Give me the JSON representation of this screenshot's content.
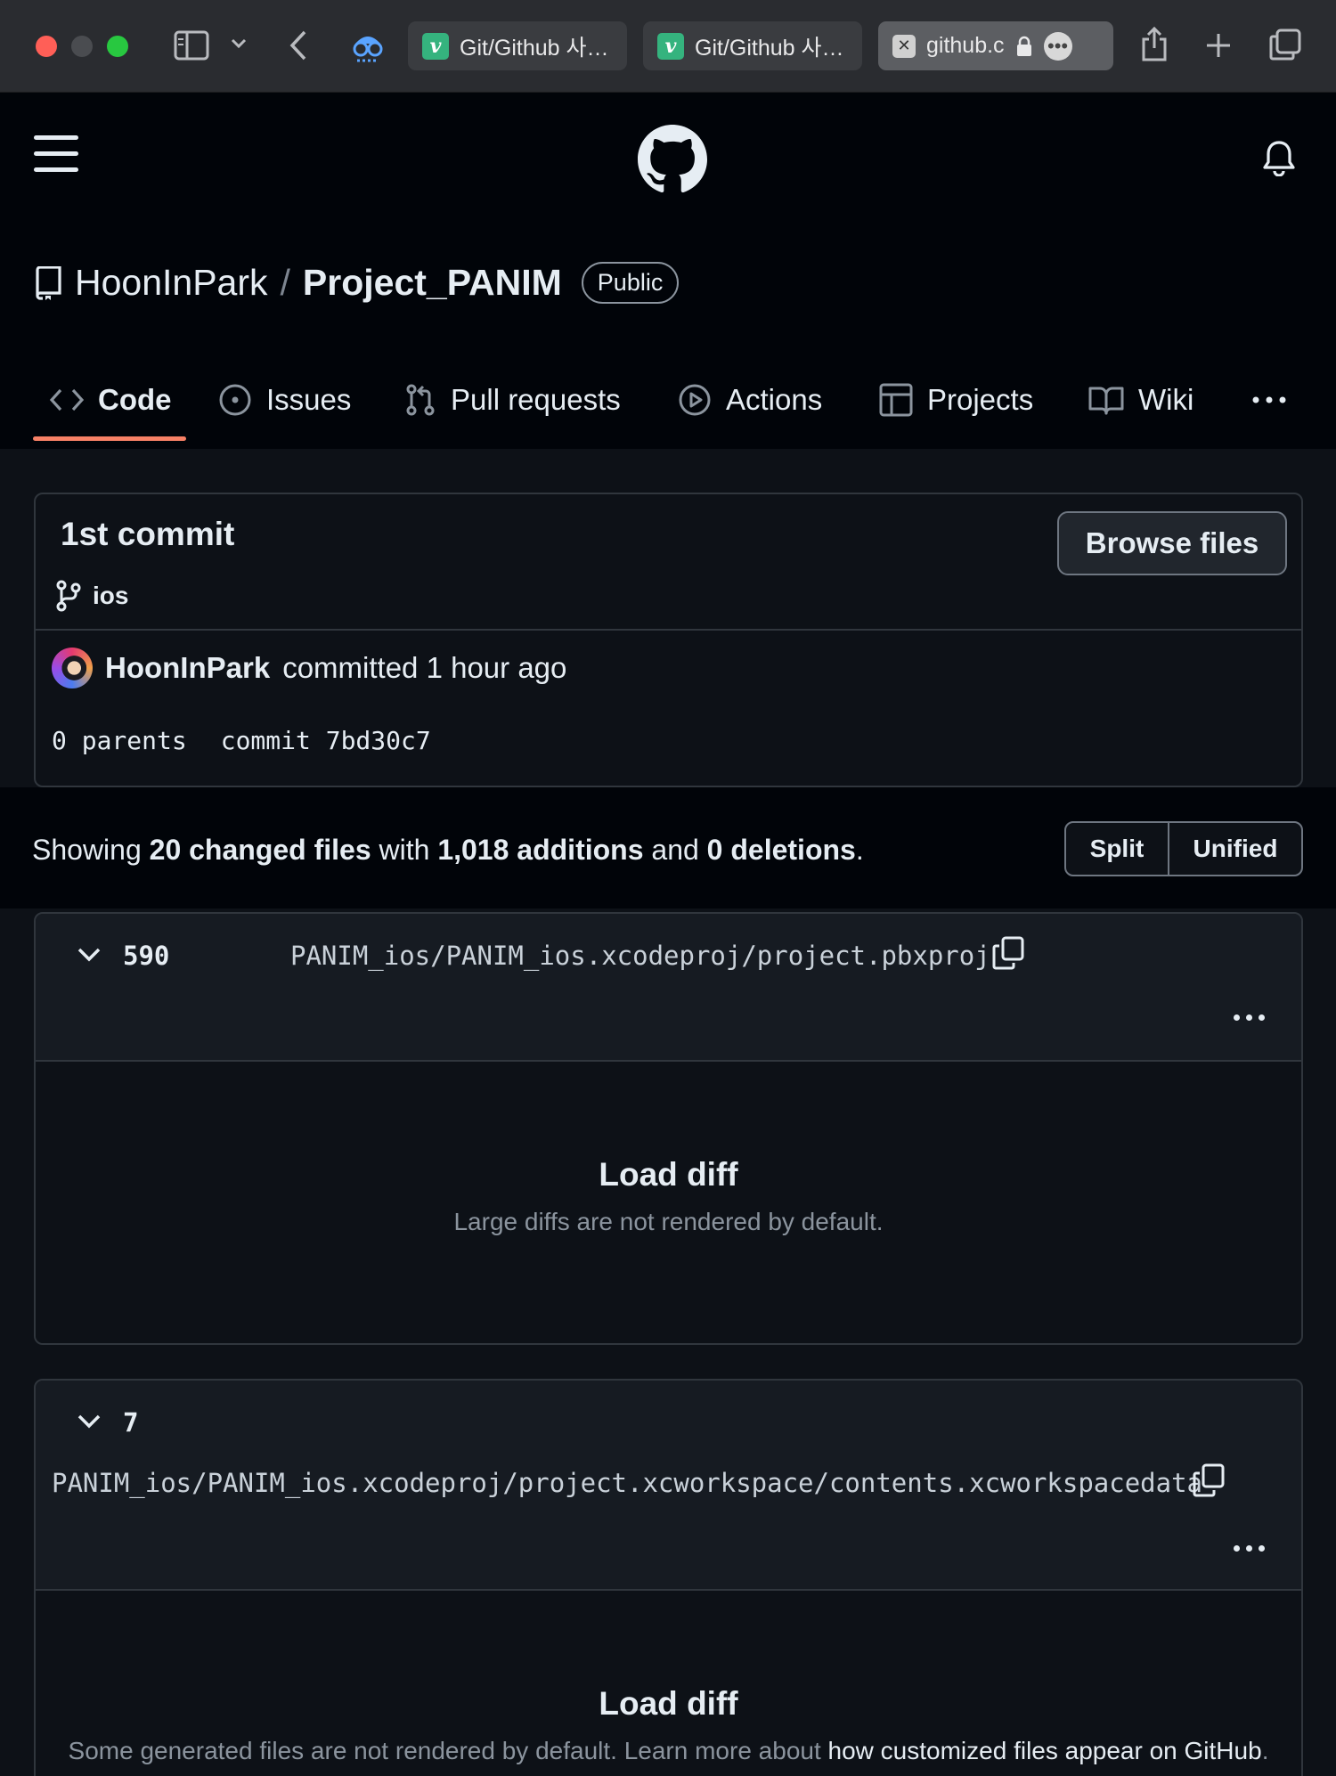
{
  "browser": {
    "tabs": [
      {
        "label": "Git/Github 사…",
        "favicon": "v-favicon",
        "active": false
      },
      {
        "label": "Git/Github 사…",
        "favicon": "v-favicon",
        "active": false
      },
      {
        "label": "github.c",
        "favicon": "x-favicon",
        "active": true
      }
    ]
  },
  "repo": {
    "owner": "HoonInPark",
    "separator": "/",
    "name": "Project_PANIM",
    "visibility": "Public"
  },
  "nav": {
    "code": "Code",
    "issues": "Issues",
    "pull_requests": "Pull requests",
    "actions": "Actions",
    "projects": "Projects",
    "wiki": "Wiki"
  },
  "commit": {
    "title": "1st commit",
    "branch": "ios",
    "browse_label": "Browse files",
    "author": "HoonInPark",
    "action_text": "committed 1 hour ago",
    "parents": "0 parents",
    "commit_hash": "commit 7bd30c7"
  },
  "summary": {
    "prefix": "Showing ",
    "files": "20 changed files",
    "with": " with ",
    "additions": "1,018 additions",
    "and": " and ",
    "deletions": "0 deletions",
    "suffix": ".",
    "split_label": "Split",
    "unified_label": "Unified"
  },
  "files": [
    {
      "count": "590",
      "path": "PANIM_ios/PANIM_ios.xcodeproj/project.pbxproj",
      "load_title": "Load diff",
      "load_sub": "Large diffs are not rendered by default."
    },
    {
      "count": "7",
      "path": "PANIM_ios/PANIM_ios.xcodeproj/project.xcworkspace/contents.xcworkspacedata",
      "load_title": "Load diff",
      "load_sub": "Some generated files are not rendered by default. Learn more about ",
      "load_link": "how customized files appear on GitHub",
      "load_sub_end": "."
    }
  ],
  "colors": {
    "page_bg": "#0d1117",
    "header_bg": "#010409",
    "border": "#30363d",
    "accent_underline": "#f78166",
    "muted_text": "#8b949e"
  }
}
